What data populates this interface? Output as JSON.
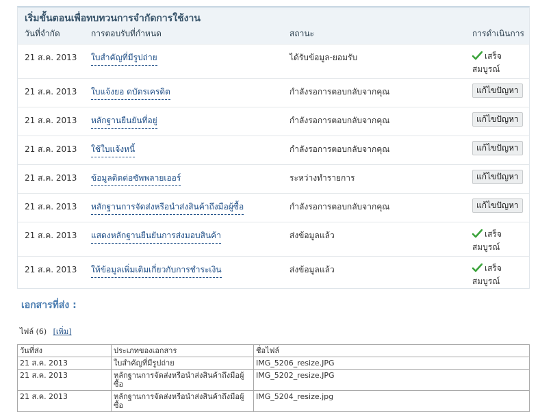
{
  "panel": {
    "title": "เริ่มขั้นตอนเพื่อทบทวนการจำกัดการใช้งาน",
    "headers": [
      "วันที่จำกัด",
      "การตอบรับที่กำหนด",
      "สถานะ",
      "การดำเนินการ"
    ],
    "rows": [
      {
        "date": "21 ส.ค. 2013",
        "response": "ใบสำคัญที่มีรูปถ่าย",
        "status": "ได้รับข้อมูล-ยอมรับ",
        "done": true,
        "action": "เสร็จสมบูรณ์"
      },
      {
        "date": "21 ส.ค. 2013",
        "response": "ใบแจ้งยอ ดบัตรเครดิต",
        "status": "กำลังรอการตอบกลับจากคุณ",
        "done": false,
        "action": "แก้ไขปัญหา"
      },
      {
        "date": "21 ส.ค. 2013",
        "response": "หลักฐานยืนยันที่อยู่",
        "status": "กำลังรอการตอบกลับจากคุณ",
        "done": false,
        "action": "แก้ไขปัญหา"
      },
      {
        "date": "21 ส.ค. 2013",
        "response": "ใช้ใบแจ้งหนี้",
        "status": "กำลังรอการตอบกลับจากคุณ",
        "done": false,
        "action": "แก้ไขปัญหา"
      },
      {
        "date": "21 ส.ค. 2013",
        "response": "ข้อมูลติดต่อซัพพลายเออร์",
        "status": "ระหว่างทำรายการ",
        "done": false,
        "action": "แก้ไขปัญหา"
      },
      {
        "date": "21 ส.ค. 2013",
        "response": "หลักฐานการจัดส่งหรือนำส่งสินค้าถึงมือผู้ซื้อ",
        "status": "กำลังรอการตอบกลับจากคุณ",
        "done": false,
        "action": "แก้ไขปัญหา"
      },
      {
        "date": "21 ส.ค. 2013",
        "response": "แสดงหลักฐานยืนยันการส่งมอบสินค้า",
        "status": "ส่งข้อมูลแล้ว",
        "done": true,
        "action": "เสร็จสมบูรณ์"
      },
      {
        "date": "21 ส.ค. 2013",
        "response": "ให้ข้อมูลเพิ่มเติมเกี่ยวกับการชำระเงิน",
        "status": "ส่งข้อมูลแล้ว",
        "done": true,
        "action": "เสร็จสมบูรณ์"
      }
    ]
  },
  "documents": {
    "heading": "เอกสารที่ส่ง :",
    "files_label": "ไฟล์ (6)",
    "add_link": "[เพิ่ม]",
    "columns": [
      "วันที่ส่ง",
      "ประเภทของเอกสาร",
      "ชื่อไฟล์"
    ],
    "rows": [
      {
        "date": "21 ส.ค. 2013",
        "type": "ใบสำคัญที่มีรูปถ่าย",
        "file": "IMG_5206_resize.JPG"
      },
      {
        "date": "21 ส.ค. 2013",
        "type": "หลักฐานการจัดส่งหรือนำส่งสินค้าถึงมือผู้ซื้อ",
        "file": "IMG_5202_resize.JPG"
      },
      {
        "date": "21 ส.ค. 2013",
        "type": "หลักฐานการจัดส่งหรือนำส่งสินค้าถึงมือผู้ซื้อ",
        "file": "IMG_5204_resize.jpg"
      }
    ]
  },
  "colors": {
    "heading_blue": "#4b7db1",
    "link_blue": "#1d4d86",
    "check_green": "#3aa33a"
  }
}
